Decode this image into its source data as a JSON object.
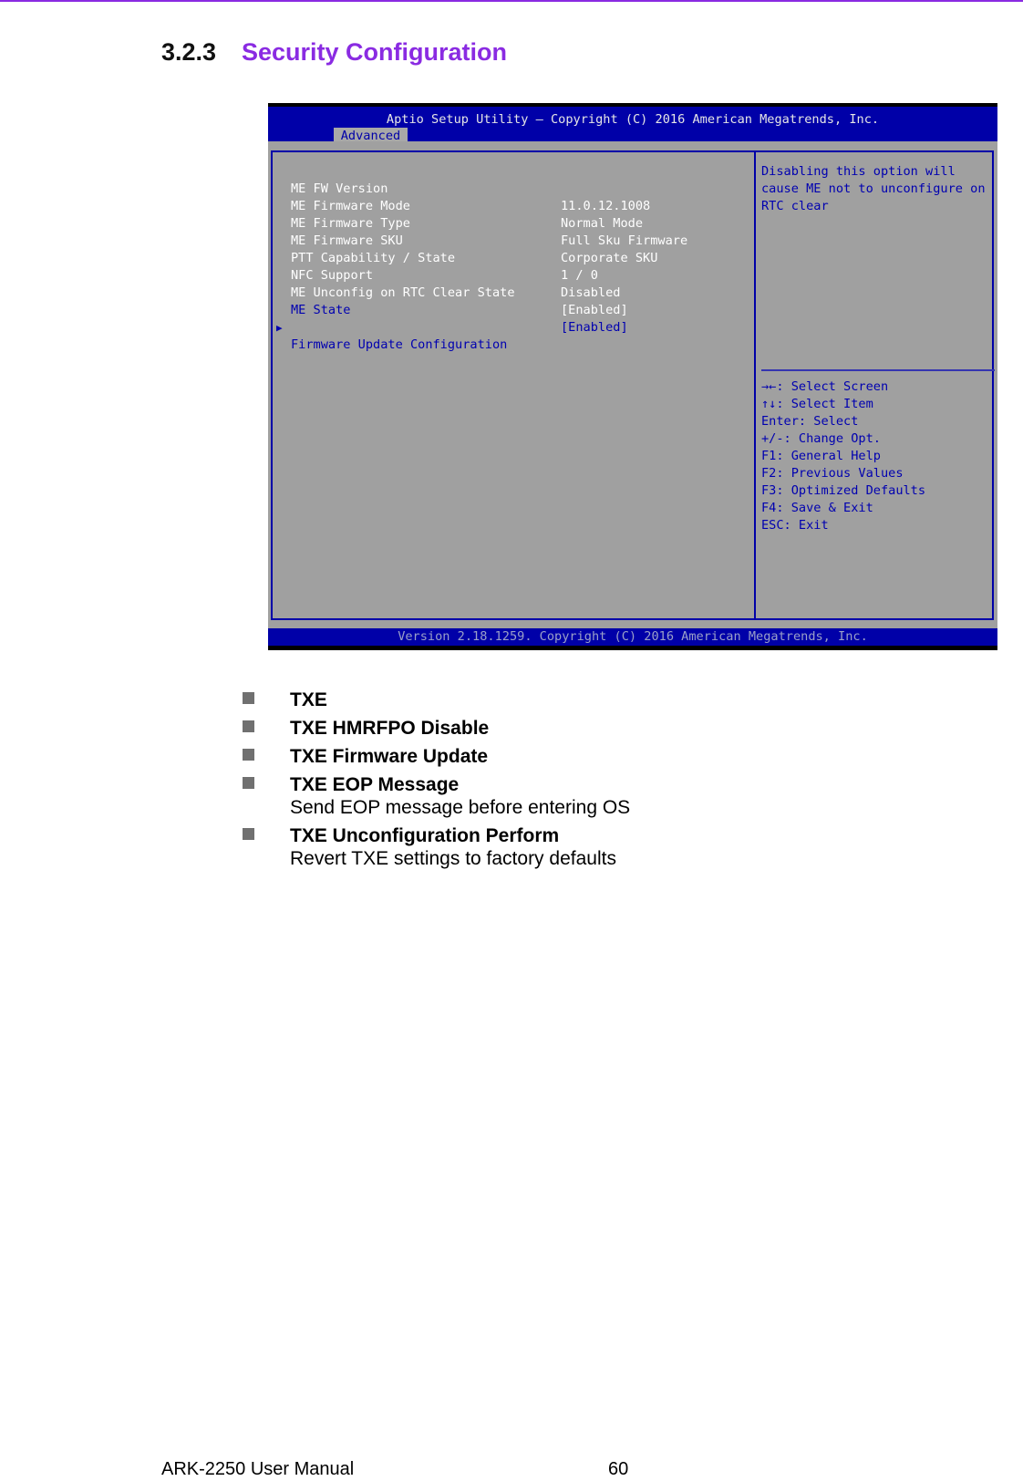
{
  "page": {
    "accent_color": "#8a2be2",
    "section_number": "3.2.3",
    "section_title": "Security Configuration",
    "footer_manual": "ARK-2250 User Manual",
    "footer_page": "60"
  },
  "bios": {
    "title": "Aptio Setup Utility – Copyright (C) 2016 American Megatrends, Inc.",
    "active_tab": "Advanced",
    "footer": "Version 2.18.1259. Copyright (C) 2016 American Megatrends, Inc.",
    "colors": {
      "header_bg": "#0000a8",
      "body_bg": "#a0a0a0",
      "option_text": "#0000b0"
    },
    "rows": [
      {
        "label": "ME FW Version",
        "value": "11.0.12.1008",
        "kind": "info"
      },
      {
        "label": "ME Firmware Mode",
        "value": "Normal Mode",
        "kind": "info"
      },
      {
        "label": "ME Firmware Type",
        "value": "Full Sku Firmware",
        "kind": "info"
      },
      {
        "label": "ME Firmware SKU",
        "value": "Corporate SKU",
        "kind": "info"
      },
      {
        "label": "PTT Capability / State",
        "value": "1 / 0",
        "kind": "info"
      },
      {
        "label": "NFC Support",
        "value": "Disabled",
        "kind": "info"
      },
      {
        "label": "ME Unconfig on RTC Clear State",
        "value": "[Enabled]",
        "kind": "selected"
      },
      {
        "label": "ME State",
        "value": "[Enabled]",
        "kind": "option"
      },
      {
        "label": "Firmware Update Configuration",
        "value": "",
        "kind": "submenu",
        "icon": "triangle-right-icon"
      }
    ],
    "help_text": [
      "Disabling this option will",
      "cause ME not to unconfigure on",
      "RTC clear"
    ],
    "key_help": [
      "→←: Select Screen",
      "↑↓: Select Item",
      "Enter: Select",
      "+/-: Change Opt.",
      "F1: General Help",
      "F2: Previous Values",
      "F3: Optimized Defaults",
      "F4: Save & Exit",
      "ESC: Exit"
    ]
  },
  "bullets": [
    {
      "title": "TXE",
      "desc": ""
    },
    {
      "title": "TXE HMRFPO Disable",
      "desc": ""
    },
    {
      "title": "TXE Firmware Update",
      "desc": ""
    },
    {
      "title": "TXE EOP Message",
      "desc": "Send EOP message before entering OS"
    },
    {
      "title": "TXE Unconfiguration Perform",
      "desc": "Revert TXE settings to factory defaults"
    }
  ]
}
